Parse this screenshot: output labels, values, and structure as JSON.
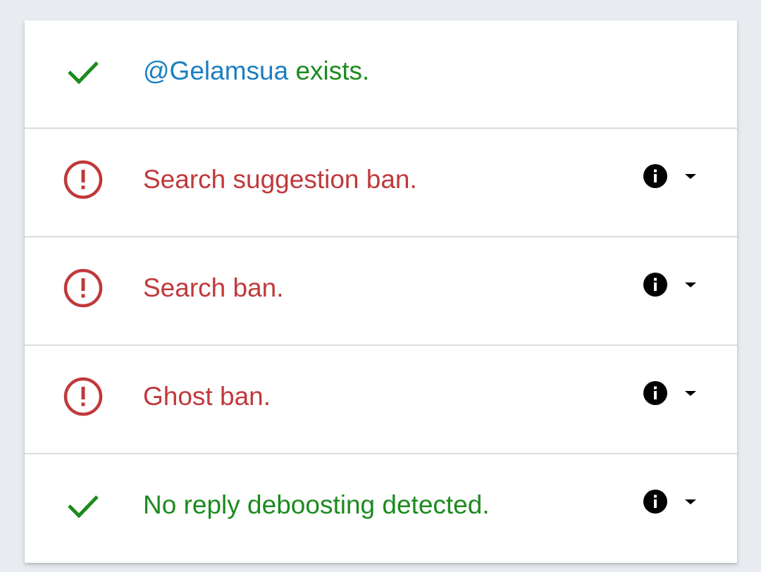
{
  "colors": {
    "ok": "#1d8a1f",
    "bad": "#c0393b",
    "handle": "#1b7fc0",
    "background": "#e8ecf0"
  },
  "results": [
    {
      "status": "ok",
      "icon": "check-icon",
      "handle": "@Gelamsua",
      "text": "exists.",
      "has_details": false
    },
    {
      "status": "bad",
      "icon": "alert-circle-icon",
      "text": "Search suggestion ban.",
      "has_details": true,
      "details_icon": "info-icon",
      "toggle_icon": "caret-down-icon"
    },
    {
      "status": "bad",
      "icon": "alert-circle-icon",
      "text": "Search ban.",
      "has_details": true,
      "details_icon": "info-icon",
      "toggle_icon": "caret-down-icon"
    },
    {
      "status": "bad",
      "icon": "alert-circle-icon",
      "text": "Ghost ban.",
      "has_details": true,
      "details_icon": "info-icon",
      "toggle_icon": "caret-down-icon"
    },
    {
      "status": "ok",
      "icon": "check-icon",
      "text": "No reply deboosting detected.",
      "has_details": true,
      "details_icon": "info-icon",
      "toggle_icon": "caret-down-icon"
    }
  ]
}
